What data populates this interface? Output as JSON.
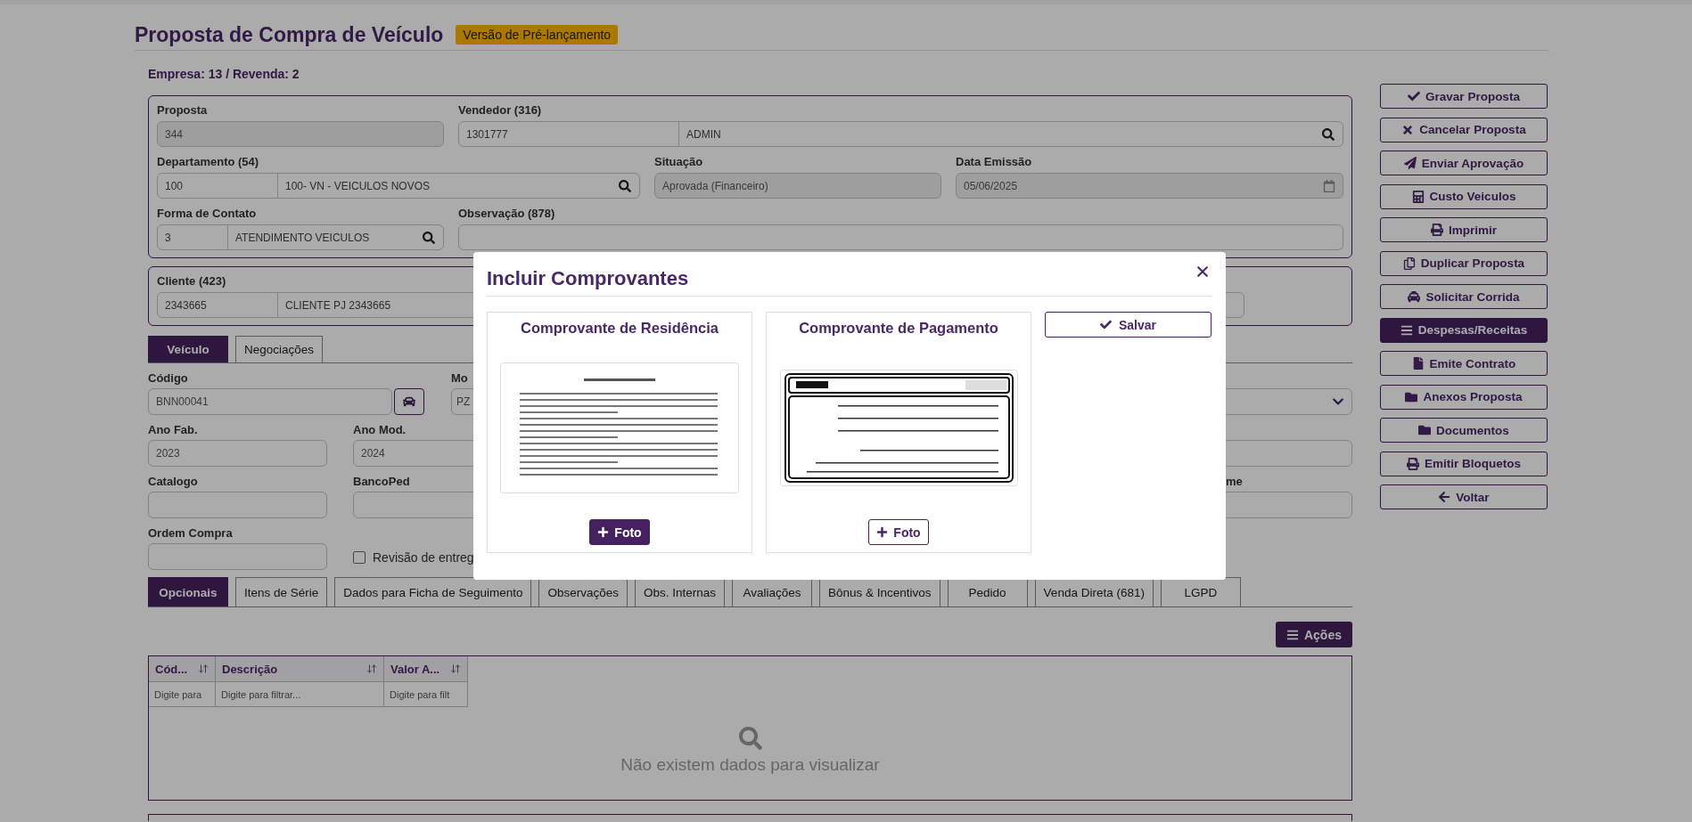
{
  "header": {
    "title": "Proposta de Compra de Veículo",
    "badge": "Versão de Pré-lançamento"
  },
  "company": "Empresa: 13 / Revenda: 2",
  "proposal_rows": [
    [
      {
        "kind": "text",
        "label": "Proposta",
        "value": "344",
        "disabled": true
      },
      {
        "kind": "lookup",
        "label": "Vendedor (316)",
        "code": "1301777",
        "name": "ADMIN",
        "search": true
      }
    ],
    [
      {
        "kind": "lookup",
        "label": "Departamento (54)",
        "code": "100",
        "name": "100- VN - VEICULOS NOVOS",
        "search": true
      },
      {
        "kind": "text",
        "label": "Situação",
        "value": "Aprovada (Financeiro)",
        "disabled": true
      },
      {
        "kind": "date",
        "label": "Data Emissão",
        "value": "05/06/2025",
        "disabled": true
      }
    ],
    [
      {
        "kind": "lookup",
        "label": "Forma de Contato",
        "code": "3",
        "name": "ATENDIMENTO VEICULOS",
        "search": true
      },
      {
        "kind": "text",
        "label": "Observação (878)",
        "disabled": false
      }
    ]
  ],
  "client": {
    "label": "Cliente (423)",
    "code": "2343665",
    "name": "CLIENTE PJ 2343665"
  },
  "vehicle_tabs": [
    {
      "label": "Veículo",
      "selected": true
    },
    {
      "label": "Negociações",
      "selected": false
    }
  ],
  "vehicle": {
    "code": {
      "label": "Código",
      "value": "BNN00041"
    },
    "model": {
      "label": "Mo",
      "value": "PZ"
    },
    "year_made": {
      "label": "Ano Fab.",
      "value": "2023"
    },
    "year_model": {
      "label": "Ano Mod.",
      "value": "2024"
    },
    "catalog": {
      "label": "Catalogo"
    },
    "bank": {
      "label": "BancoPed"
    },
    "side_label": "me",
    "purchase_order": {
      "label": "Ordem Compra"
    },
    "review": {
      "label": "Revisão de entreg",
      "checked": false
    }
  },
  "detail_tabs": [
    {
      "label": "Opcionais",
      "selected": true
    },
    {
      "label": "Itens de Série",
      "selected": false
    },
    {
      "label": "Dados para Ficha de Seguimento",
      "selected": false
    },
    {
      "label": "Observações",
      "selected": false
    },
    {
      "label": "Obs. Internas",
      "selected": false
    },
    {
      "label": "Avaliações",
      "selected": false
    },
    {
      "label": "Bônus & Incentivos",
      "selected": false
    },
    {
      "label": "Pedido",
      "selected": false
    },
    {
      "label": "Venda Direta (681)",
      "selected": false
    },
    {
      "label": "LGPD",
      "selected": false
    }
  ],
  "actions_button": "Ações",
  "table": {
    "columns": [
      "Cód...",
      "Descrição",
      "Valor A..."
    ],
    "placeholders": [
      "Digite para",
      "Digite para filtrar...",
      "Digite para filt"
    ],
    "empty_message": "Não existem dados para visualizar"
  },
  "side_buttons": [
    {
      "label": "Gravar Proposta",
      "primary": false
    },
    {
      "label": "Cancelar Proposta",
      "primary": false
    },
    {
      "label": "Enviar Aprovação",
      "primary": false
    },
    {
      "label": "Custo Veiculos",
      "primary": false
    },
    {
      "label": "Imprimir",
      "primary": false
    },
    {
      "label": "Duplicar Proposta",
      "primary": false
    },
    {
      "label": "Solicitar Corrida",
      "primary": false
    },
    {
      "label": "Despesas/Receitas",
      "primary": true
    },
    {
      "label": "Emite Contrato",
      "primary": false
    },
    {
      "label": "Anexos Proposta",
      "primary": false
    },
    {
      "label": "Documentos",
      "primary": false
    },
    {
      "label": "Emitir Bloquetos",
      "primary": false
    },
    {
      "label": "Voltar",
      "primary": false
    }
  ],
  "modal": {
    "title": "Incluir Comprovantes",
    "cards": [
      {
        "title": "Comprovante de Residência",
        "button": {
          "label": "Foto",
          "primary": true
        }
      },
      {
        "title": "Comprovante de Pagamento",
        "button": {
          "label": "Foto",
          "primary": false
        }
      }
    ],
    "save_button": "Salvar"
  }
}
